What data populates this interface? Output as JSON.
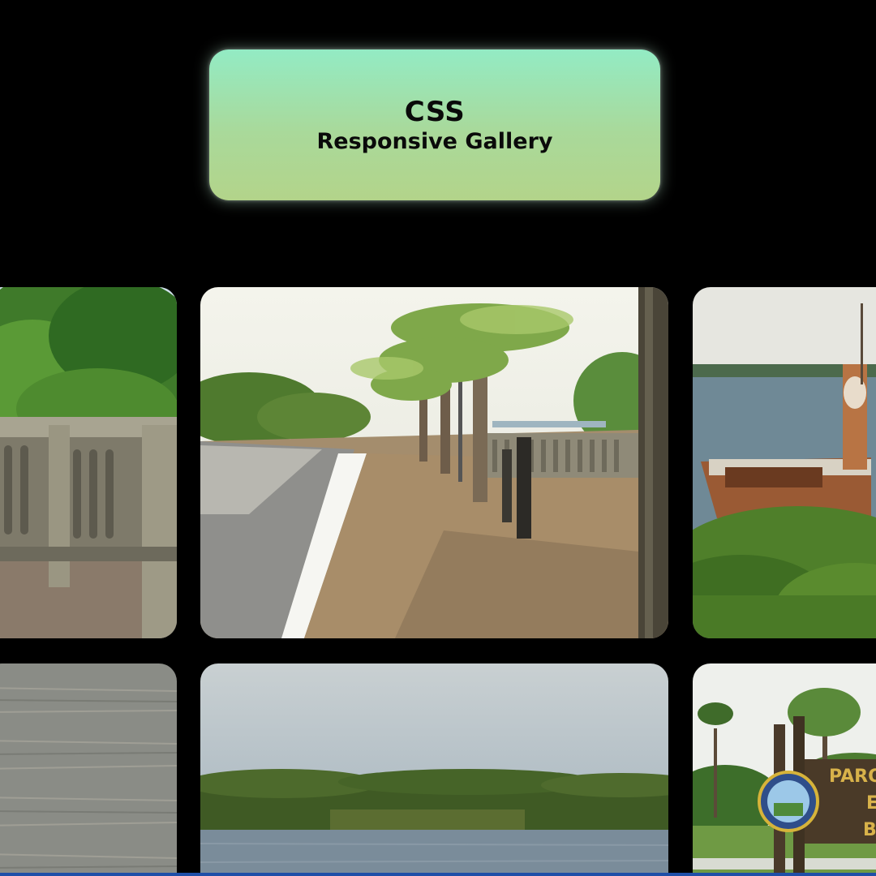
{
  "header": {
    "title": "CSS",
    "subtitle": "Responsive Gallery"
  },
  "gallery": {
    "photos": [
      {
        "subject": "stone balustrade with green trees"
      },
      {
        "subject": "riverside promenade with palm trees"
      },
      {
        "subject": "old rusty boat at the river shore"
      },
      {
        "subject": "river water surface"
      },
      {
        "subject": "river with forested far shore"
      },
      {
        "subject": "park entrance sign with palm trees"
      }
    ],
    "sign_text": {
      "line1": "PARQ",
      "line2": "E",
      "line3": "BI"
    }
  },
  "colors": {
    "background": "#000000",
    "header_gradient_top": "#93ebc4",
    "header_gradient_bottom": "#b3d48a"
  }
}
